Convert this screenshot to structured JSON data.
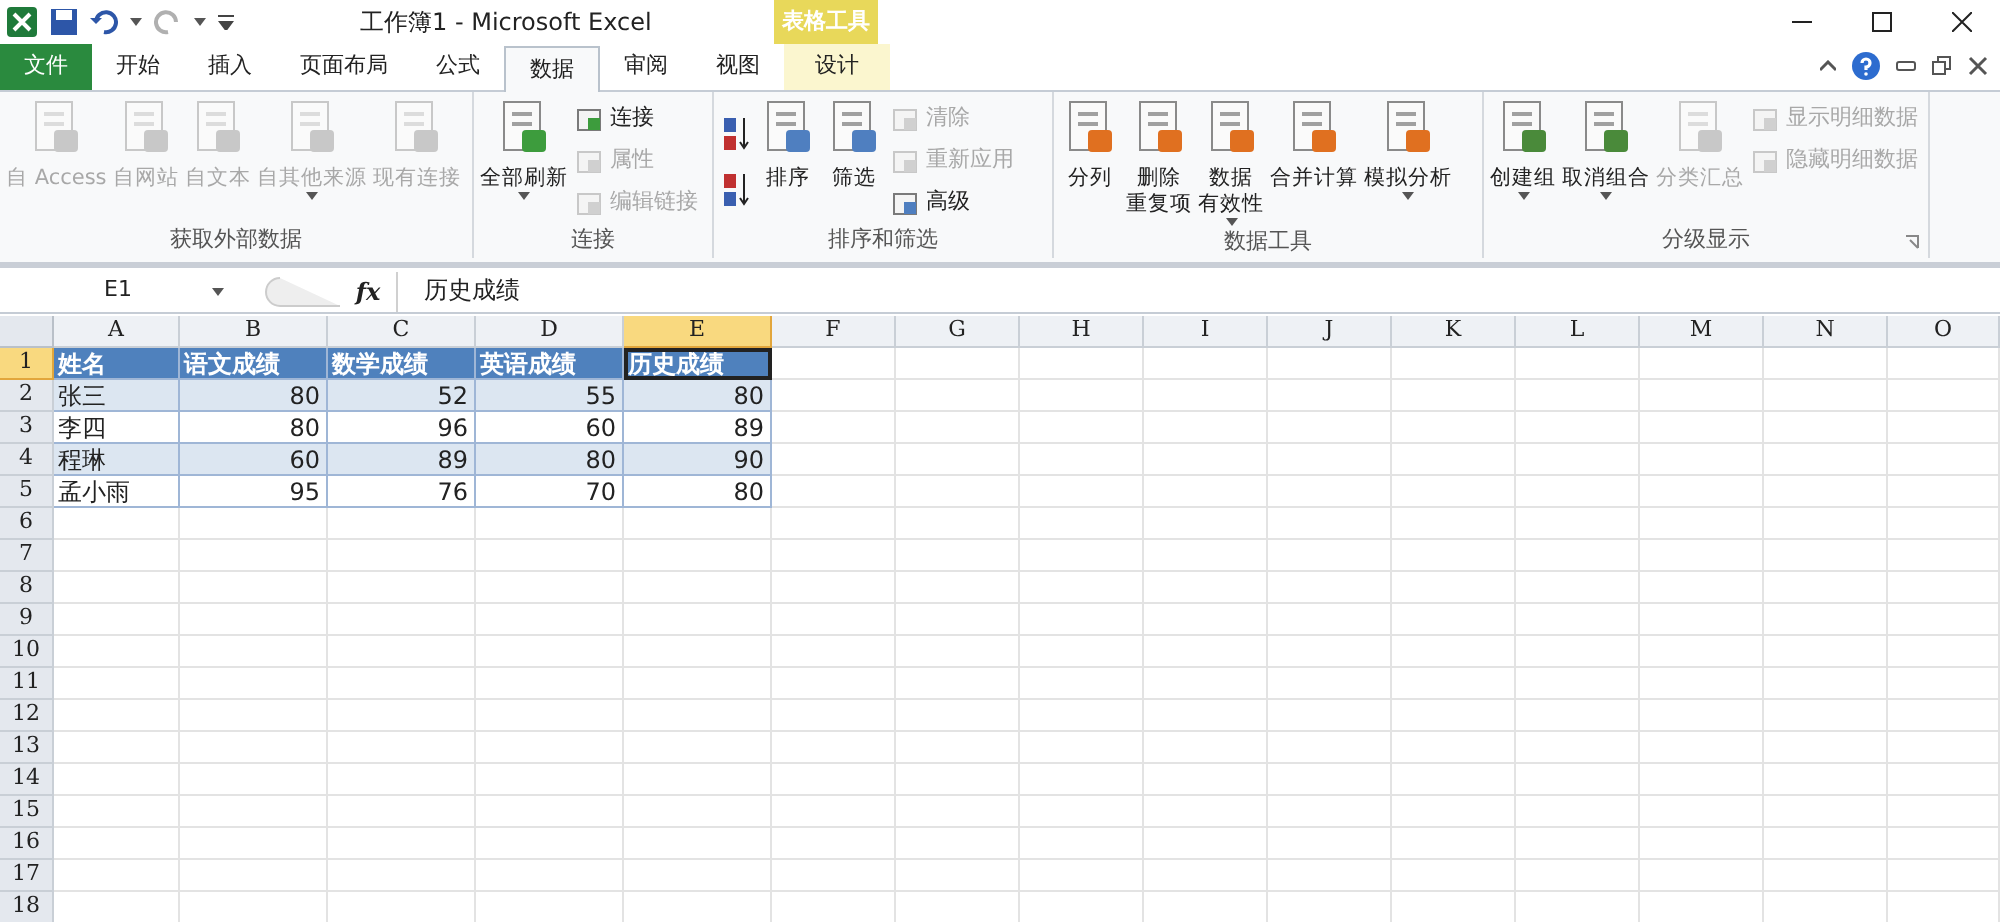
{
  "window": {
    "title": "工作簿1  -  Microsoft Excel",
    "context_label": "表格工具"
  },
  "tabs": [
    {
      "label": "文件",
      "kind": "file",
      "selected": false
    },
    {
      "label": "开始",
      "kind": "normal",
      "selected": false
    },
    {
      "label": "插入",
      "kind": "normal",
      "selected": false
    },
    {
      "label": "页面布局",
      "kind": "normal",
      "selected": false
    },
    {
      "label": "公式",
      "kind": "normal",
      "selected": false
    },
    {
      "label": "数据",
      "kind": "normal",
      "selected": true
    },
    {
      "label": "审阅",
      "kind": "normal",
      "selected": false
    },
    {
      "label": "视图",
      "kind": "normal",
      "selected": false
    },
    {
      "label": "设计",
      "kind": "context",
      "selected": false
    }
  ],
  "ribbon_groups": [
    {
      "label": "获取外部数据",
      "buttons": [
        {
          "label": "自 Access",
          "kind": "large",
          "disabled": true,
          "dropdown": false
        },
        {
          "label": "自网站",
          "kind": "large",
          "disabled": true,
          "dropdown": false
        },
        {
          "label": "自文本",
          "kind": "large",
          "disabled": true,
          "dropdown": false
        },
        {
          "label": "自其他来源",
          "kind": "large",
          "disabled": true,
          "dropdown": true
        },
        {
          "label": "现有连接",
          "kind": "large",
          "disabled": true,
          "dropdown": false
        }
      ]
    },
    {
      "label": "连接",
      "buttons": [
        {
          "label": "全部刷新",
          "kind": "large",
          "disabled": false,
          "dropdown": true
        },
        {
          "label": "连接",
          "kind": "small",
          "disabled": false
        },
        {
          "label": "属性",
          "kind": "small",
          "disabled": true
        },
        {
          "label": "编辑链接",
          "kind": "small",
          "disabled": true
        }
      ]
    },
    {
      "label": "排序和筛选",
      "buttons": [
        {
          "kind": "sortpair"
        },
        {
          "label": "排序",
          "kind": "large",
          "disabled": false,
          "dropdown": false
        },
        {
          "label": "筛选",
          "kind": "large",
          "disabled": false,
          "dropdown": false
        },
        {
          "label": "清除",
          "kind": "small",
          "disabled": true
        },
        {
          "label": "重新应用",
          "kind": "small",
          "disabled": true
        },
        {
          "label": "高级",
          "kind": "small",
          "disabled": false
        }
      ]
    },
    {
      "label": "数据工具",
      "buttons": [
        {
          "label": "分列",
          "kind": "large",
          "disabled": false,
          "dropdown": false
        },
        {
          "label_lines": [
            "删除",
            "重复项"
          ],
          "kind": "large",
          "disabled": false,
          "dropdown": false
        },
        {
          "label_lines": [
            "数据",
            "有效性"
          ],
          "kind": "large",
          "disabled": false,
          "dropdown": true
        },
        {
          "label": "合并计算",
          "kind": "large",
          "disabled": false,
          "dropdown": false
        },
        {
          "label": "模拟分析",
          "kind": "large",
          "disabled": false,
          "dropdown": true
        }
      ]
    },
    {
      "label": "分级显示",
      "launcher": true,
      "buttons": [
        {
          "label": "创建组",
          "kind": "large",
          "disabled": false,
          "dropdown": true
        },
        {
          "label": "取消组合",
          "kind": "large",
          "disabled": false,
          "dropdown": true
        },
        {
          "label": "分类汇总",
          "kind": "large",
          "disabled": true,
          "dropdown": false
        },
        {
          "label": "显示明细数据",
          "kind": "small",
          "disabled": true
        },
        {
          "label": "隐藏明细数据",
          "kind": "small",
          "disabled": true
        }
      ]
    }
  ],
  "formula_bar": {
    "name_box": "E1",
    "fx": "fx",
    "value": "历史成绩"
  },
  "columns": [
    {
      "label": "A",
      "selected": false
    },
    {
      "label": "B",
      "selected": false
    },
    {
      "label": "C",
      "selected": false
    },
    {
      "label": "D",
      "selected": false
    },
    {
      "label": "E",
      "selected": true
    },
    {
      "label": "F",
      "selected": false
    },
    {
      "label": "G",
      "selected": false
    },
    {
      "label": "H",
      "selected": false
    },
    {
      "label": "I",
      "selected": false
    },
    {
      "label": "J",
      "selected": false
    },
    {
      "label": "K",
      "selected": false
    },
    {
      "label": "L",
      "selected": false
    },
    {
      "label": "M",
      "selected": false
    },
    {
      "label": "N",
      "selected": false
    },
    {
      "label": "O",
      "selected": false
    }
  ],
  "rows": [
    {
      "number": "1",
      "selected": true,
      "kind": "header",
      "cells": [
        {
          "text": "姓名",
          "selected": false
        },
        {
          "text": "语文成绩",
          "selected": false
        },
        {
          "text": "数学成绩",
          "selected": false
        },
        {
          "text": "英语成绩",
          "selected": false
        },
        {
          "text": "历史成绩",
          "selected": true
        }
      ]
    },
    {
      "number": "2",
      "selected": false,
      "kind": "band",
      "cells": [
        {
          "text": "张三",
          "selected": false
        },
        {
          "text": "80",
          "selected": false
        },
        {
          "text": "52",
          "selected": false
        },
        {
          "text": "55",
          "selected": false
        },
        {
          "text": "80",
          "selected": false
        }
      ]
    },
    {
      "number": "3",
      "selected": false,
      "kind": "plain",
      "cells": [
        {
          "text": "李四",
          "selected": false
        },
        {
          "text": "80",
          "selected": false
        },
        {
          "text": "96",
          "selected": false
        },
        {
          "text": "60",
          "selected": false
        },
        {
          "text": "89",
          "selected": false
        }
      ]
    },
    {
      "number": "4",
      "selected": false,
      "kind": "band",
      "cells": [
        {
          "text": "程琳",
          "selected": false
        },
        {
          "text": "60",
          "selected": false
        },
        {
          "text": "89",
          "selected": false
        },
        {
          "text": "80",
          "selected": false
        },
        {
          "text": "90",
          "selected": false
        }
      ]
    },
    {
      "number": "5",
      "selected": false,
      "kind": "plain",
      "cells": [
        {
          "text": "孟小雨",
          "selected": false
        },
        {
          "text": "95",
          "selected": false
        },
        {
          "text": "76",
          "selected": false
        },
        {
          "text": "70",
          "selected": false
        },
        {
          "text": "80",
          "selected": false
        }
      ]
    },
    {
      "number": "6",
      "selected": false,
      "kind": "empty",
      "cells": []
    },
    {
      "number": "7",
      "selected": false,
      "kind": "empty",
      "cells": []
    },
    {
      "number": "8",
      "selected": false,
      "kind": "empty",
      "cells": []
    },
    {
      "number": "9",
      "selected": false,
      "kind": "empty",
      "cells": []
    },
    {
      "number": "10",
      "selected": false,
      "kind": "empty",
      "cells": []
    },
    {
      "number": "11",
      "selected": false,
      "kind": "empty",
      "cells": []
    },
    {
      "number": "12",
      "selected": false,
      "kind": "empty",
      "cells": []
    },
    {
      "number": "13",
      "selected": false,
      "kind": "empty",
      "cells": []
    },
    {
      "number": "14",
      "selected": false,
      "kind": "empty",
      "cells": []
    },
    {
      "number": "15",
      "selected": false,
      "kind": "empty",
      "cells": []
    },
    {
      "number": "16",
      "selected": false,
      "kind": "empty",
      "cells": []
    },
    {
      "number": "17",
      "selected": false,
      "kind": "empty",
      "cells": []
    },
    {
      "number": "18",
      "selected": false,
      "kind": "empty",
      "cells": []
    }
  ]
}
